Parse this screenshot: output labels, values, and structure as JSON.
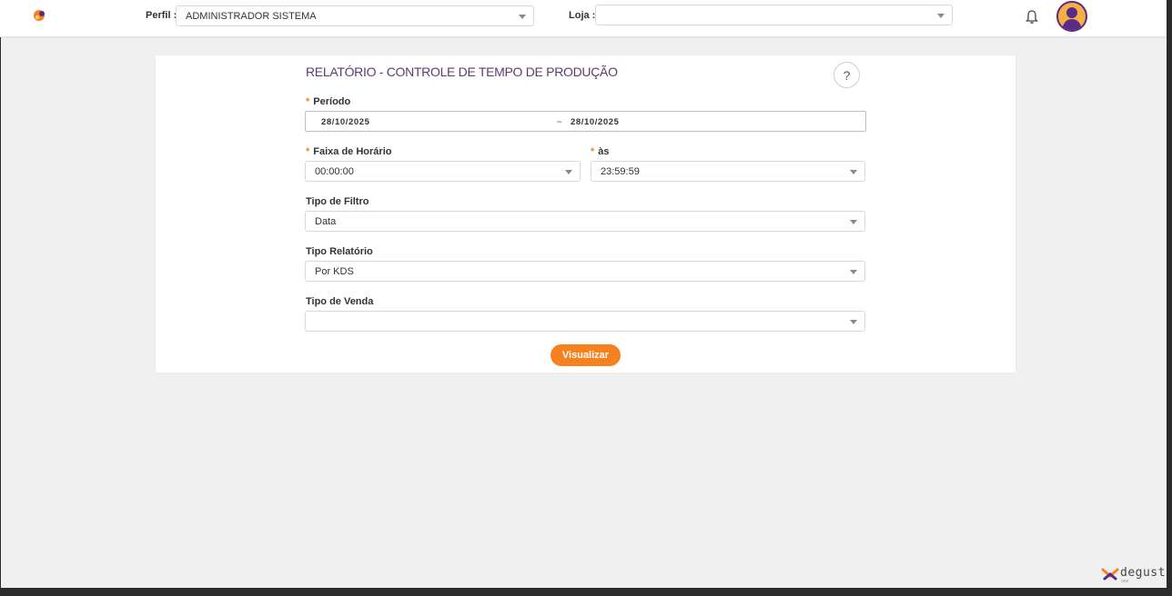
{
  "header": {
    "perfil_label": "Perfil :",
    "perfil_value": "ADMINISTRADOR SISTEMA",
    "loja_label": "Loja :",
    "loja_value": ""
  },
  "report": {
    "title": "RELATÓRIO - CONTROLE DE TEMPO DE PRODUÇÃO",
    "help_symbol": "?",
    "periodo": {
      "label": "Período",
      "start": "28/10/2025",
      "separator": "~",
      "end": "28/10/2025"
    },
    "faixa": {
      "label": "Faixa de Horário",
      "value": "00:00:00"
    },
    "as": {
      "label": "às",
      "value": "23:59:59"
    },
    "tipo_filtro": {
      "label": "Tipo de Filtro",
      "value": "Data"
    },
    "tipo_relatorio": {
      "label": "Tipo Relatório",
      "value": "Por KDS"
    },
    "tipo_venda": {
      "label": "Tipo de Venda",
      "value": ""
    },
    "submit_label": "Visualizar",
    "required_mark": "*"
  },
  "brand": {
    "name": "degust",
    "sub": "one"
  },
  "colors": {
    "accent": "#f5821f",
    "title": "#5a3d70",
    "avatar_ring": "#5b2a86"
  },
  "icons": [
    "app-logo-icon",
    "chevron-down-icon",
    "bell-icon",
    "user-avatar-icon",
    "help-icon",
    "degust-logo-icon"
  ]
}
